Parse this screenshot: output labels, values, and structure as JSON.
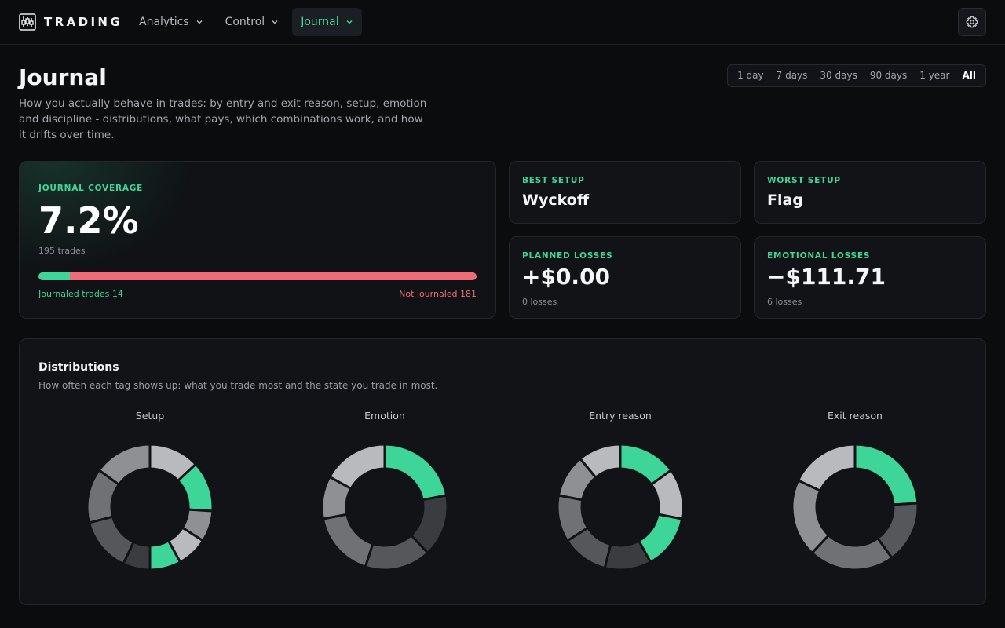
{
  "brand": {
    "name": "TRADING"
  },
  "nav": [
    {
      "label": "Analytics",
      "active": false
    },
    {
      "label": "Control",
      "active": false
    },
    {
      "label": "Journal",
      "active": true
    }
  ],
  "header": {
    "title": "Journal",
    "description": "How you actually behave in trades: by entry and exit reason, setup, emotion and discipline - distributions, what pays, which combinations work, and how it drifts over time."
  },
  "range": {
    "options": [
      "1 day",
      "7 days",
      "30 days",
      "90 days",
      "1 year",
      "All"
    ],
    "selected": "All"
  },
  "coverage": {
    "label": "JOURNAL COVERAGE",
    "percent_text": "7.2%",
    "trades_text": "195 trades",
    "journaled_fraction": 0.072,
    "journaled_text": "Journaled trades 14",
    "not_journaled_text": "Not journaled 181"
  },
  "best_setup": {
    "label": "BEST SETUP",
    "value": "Wyckoff"
  },
  "worst_setup": {
    "label": "WORST SETUP",
    "value": "Flag"
  },
  "planned_losses": {
    "label": "PLANNED LOSSES",
    "value": "+$0.00",
    "sub": "0 losses"
  },
  "emotional_losses": {
    "label": "EMOTIONAL LOSSES",
    "value": "−$111.71",
    "sub": "6 losses"
  },
  "distributions": {
    "title": "Distributions",
    "subtitle": "How often each tag shows up: what you trade most and the state you trade in most.",
    "charts": [
      {
        "title": "Setup",
        "segments": [
          {
            "value": 13,
            "color": "#b8babd"
          },
          {
            "value": 13,
            "color": "#3dd598"
          },
          {
            "value": 8,
            "color": "#8e9094"
          },
          {
            "value": 8,
            "color": "#b8babd"
          },
          {
            "value": 8,
            "color": "#3dd598"
          },
          {
            "value": 7,
            "color": "#3a3c40"
          },
          {
            "value": 14,
            "color": "#55575b"
          },
          {
            "value": 14,
            "color": "#6f7175"
          },
          {
            "value": 15,
            "color": "#8e9094"
          }
        ]
      },
      {
        "title": "Emotion",
        "segments": [
          {
            "value": 22,
            "color": "#3dd598"
          },
          {
            "value": 16,
            "color": "#3a3c40"
          },
          {
            "value": 17,
            "color": "#55575b"
          },
          {
            "value": 17,
            "color": "#6f7175"
          },
          {
            "value": 11,
            "color": "#8e9094"
          },
          {
            "value": 17,
            "color": "#b8babd"
          }
        ]
      },
      {
        "title": "Entry reason",
        "segments": [
          {
            "value": 15,
            "color": "#3dd598"
          },
          {
            "value": 13,
            "color": "#b8babd"
          },
          {
            "value": 14,
            "color": "#3dd598"
          },
          {
            "value": 12,
            "color": "#3a3c40"
          },
          {
            "value": 12,
            "color": "#55575b"
          },
          {
            "value": 12,
            "color": "#6f7175"
          },
          {
            "value": 11,
            "color": "#8e9094"
          },
          {
            "value": 11,
            "color": "#b8babd"
          }
        ]
      },
      {
        "title": "Exit reason",
        "segments": [
          {
            "value": 24,
            "color": "#3dd598"
          },
          {
            "value": 16,
            "color": "#55575b"
          },
          {
            "value": 22,
            "color": "#6f7175"
          },
          {
            "value": 20,
            "color": "#8e9094"
          },
          {
            "value": 18,
            "color": "#b8babd"
          }
        ]
      }
    ]
  }
}
